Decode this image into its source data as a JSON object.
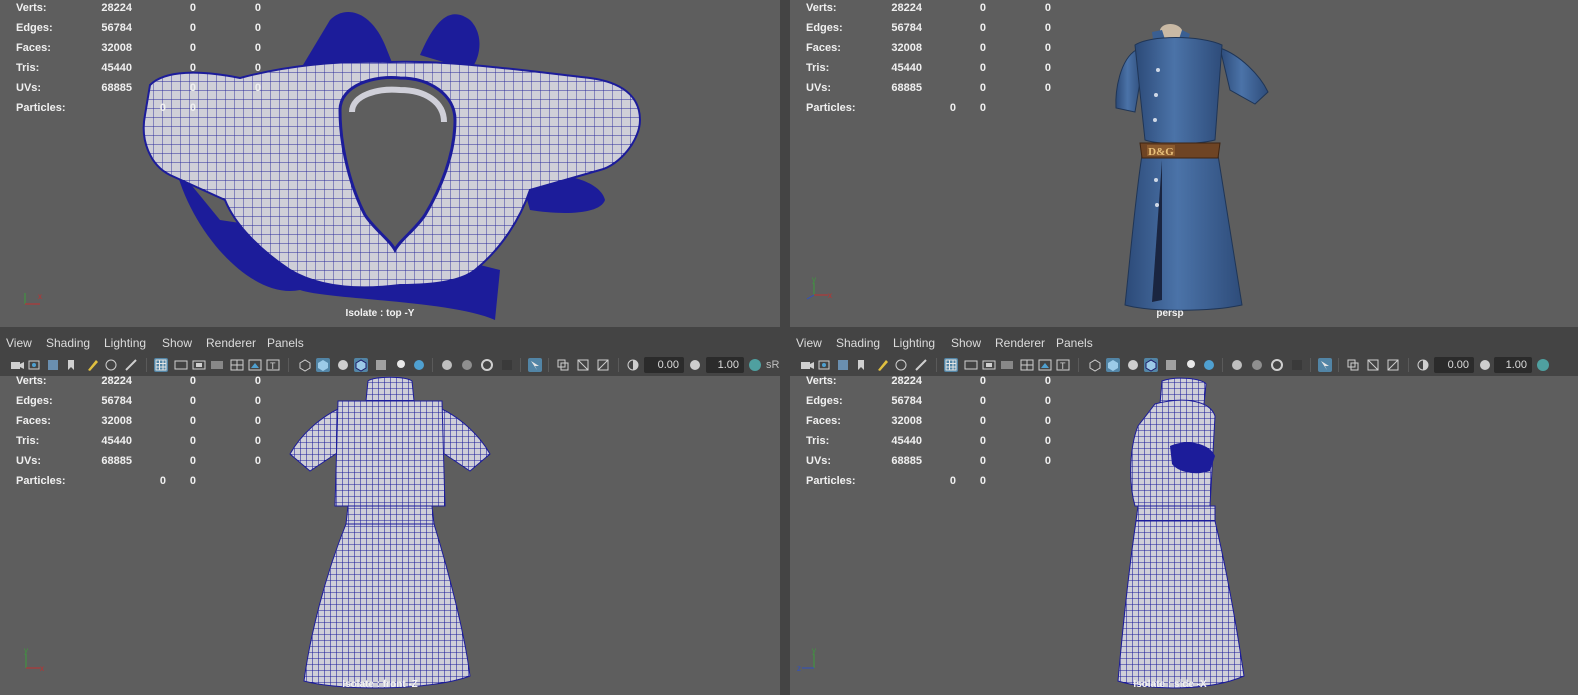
{
  "stats": {
    "rows": [
      {
        "label": "Verts:",
        "v1": "28224",
        "v2": "0",
        "v3": "0"
      },
      {
        "label": "Edges:",
        "v1": "56784",
        "v2": "0",
        "v3": "0"
      },
      {
        "label": "Faces:",
        "v1": "32008",
        "v2": "0",
        "v3": "0"
      },
      {
        "label": "Tris:",
        "v1": "45440",
        "v2": "0",
        "v3": "0"
      },
      {
        "label": "UVs:",
        "v1": "68885",
        "v2": "0",
        "v3": "0"
      }
    ],
    "particles": {
      "label": "Particles:",
      "p1": "0",
      "p2": "0"
    }
  },
  "viewports": {
    "top_left": {
      "label": "Isolate : top -Y"
    },
    "top_right": {
      "label": "persp"
    },
    "bottom_left": {
      "label": "Isolate : front -Z"
    },
    "bottom_right": {
      "label": "Isolate : side -X"
    }
  },
  "menu": [
    "View",
    "Shading",
    "Lighting",
    "Show",
    "Renderer",
    "Panels"
  ],
  "toolbar": {
    "exposure": "0.00",
    "gamma": "1.00",
    "colorspace_label": "sR"
  },
  "belt_text": "D&G",
  "colors": {
    "wire": "#1a1a8c",
    "fabric": "#3f6498",
    "viewport_bg": "#5e5e5e",
    "highlight": "#5285a6"
  }
}
